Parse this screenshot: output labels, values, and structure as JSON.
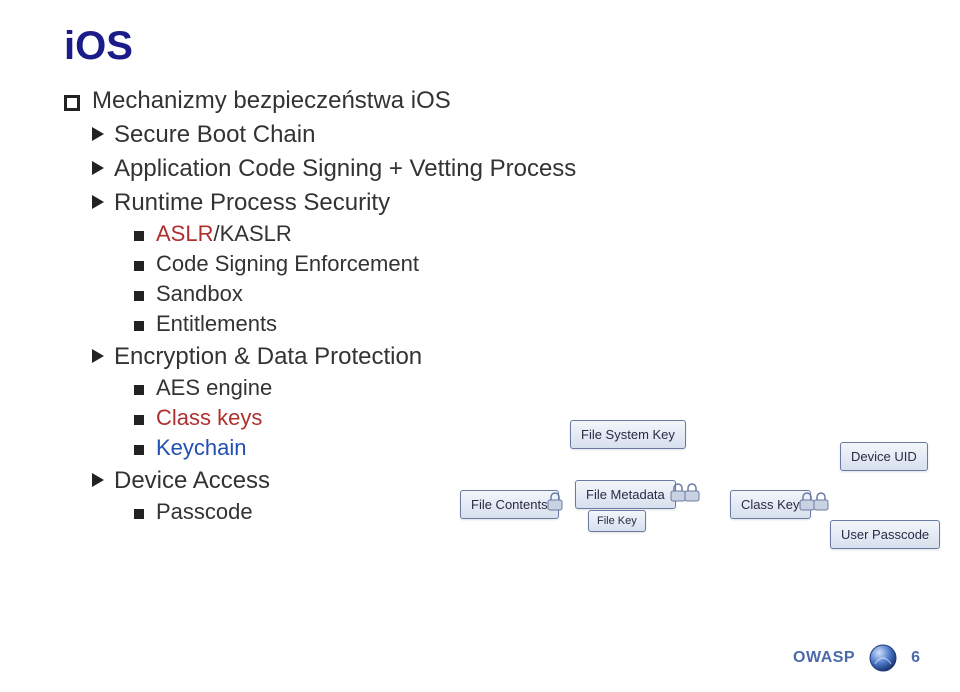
{
  "title": "iOS",
  "bullets": {
    "main": "Mechanizmy bezpieczeństwa iOS",
    "items": [
      {
        "label": "Secure Boot Chain"
      },
      {
        "label": "Application Code Signing + Vetting Process"
      },
      {
        "label": "Runtime Process Security",
        "sub": [
          {
            "prefix": "ASLR",
            "suffix": "/KASLR"
          },
          {
            "text": "Code Signing Enforcement"
          },
          {
            "text": "Sandbox"
          },
          {
            "text": "Entitlements"
          }
        ]
      },
      {
        "label": "Encryption & Data Protection",
        "sub": [
          {
            "text": "AES engine"
          },
          {
            "text": "Class keys",
            "class": "class-keys"
          },
          {
            "text": "Keychain",
            "class": "keychain"
          }
        ]
      },
      {
        "label": "Device Access",
        "sub": [
          {
            "text": "Passcode"
          }
        ]
      }
    ]
  },
  "diagram": {
    "file_system_key": "File System Key",
    "file_contents": "File Contents",
    "file_metadata": "File Metadata",
    "file_key": "File Key",
    "class_key": "Class Key",
    "device_uid": "Device UID",
    "user_passcode": "User Passcode"
  },
  "footer": {
    "brand": "OWASP",
    "page": "6"
  }
}
